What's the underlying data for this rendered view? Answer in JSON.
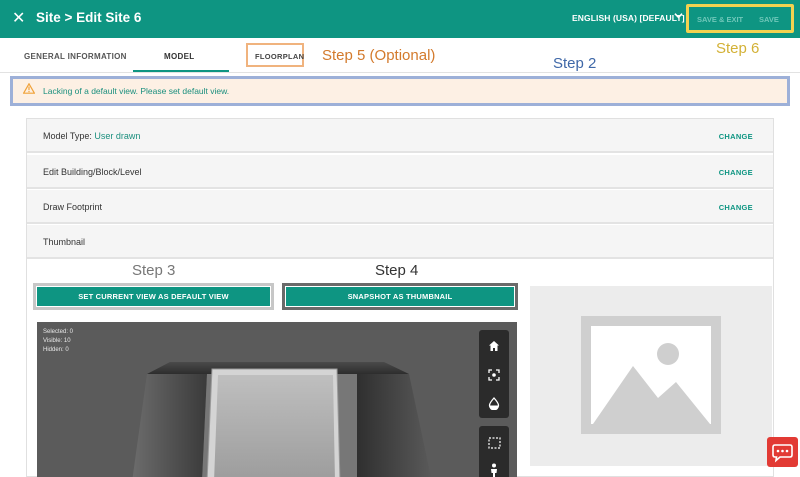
{
  "header": {
    "close_glyph": "✕",
    "title": "Site > Edit Site 6",
    "language": "ENGLISH (USA) [DEFAULT]",
    "save_exit_label": "SAVE & EXIT",
    "save_label": "SAVE",
    "accent_color": "#0e9582"
  },
  "tabs": [
    {
      "label": "GENERAL INFORMATION"
    },
    {
      "label": "MODEL"
    },
    {
      "label": "FLOORPLAN"
    }
  ],
  "annotations": {
    "step2": "Step 2",
    "step3": "Step 3",
    "step4": "Step 4",
    "step5": "Step 5 (Optional)",
    "step6": "Step 6"
  },
  "warning": {
    "text": "Lacking of a default view. Please set default view.",
    "icon": "warning-triangle-icon"
  },
  "rows": [
    {
      "label": "Model Type:",
      "value": "User drawn",
      "action": "CHANGE"
    },
    {
      "label": "Edit Building/Block/Level",
      "action": "CHANGE"
    },
    {
      "label": "Draw Footprint",
      "action": "CHANGE"
    },
    {
      "label": "Thumbnail"
    }
  ],
  "buttons": {
    "set_default_view": "SET CURRENT VIEW AS DEFAULT VIEW",
    "snapshot_thumbnail": "SNAPSHOT AS THUMBNAIL"
  },
  "viewer": {
    "selected": "Selected: 0",
    "visible": "Visible: 10",
    "hidden": "Hidden: 0",
    "tools": [
      "home-icon",
      "fit-view-icon",
      "transparency-icon",
      "box-select-icon",
      "person-icon"
    ]
  },
  "chat": {
    "icon": "chat-icon"
  }
}
